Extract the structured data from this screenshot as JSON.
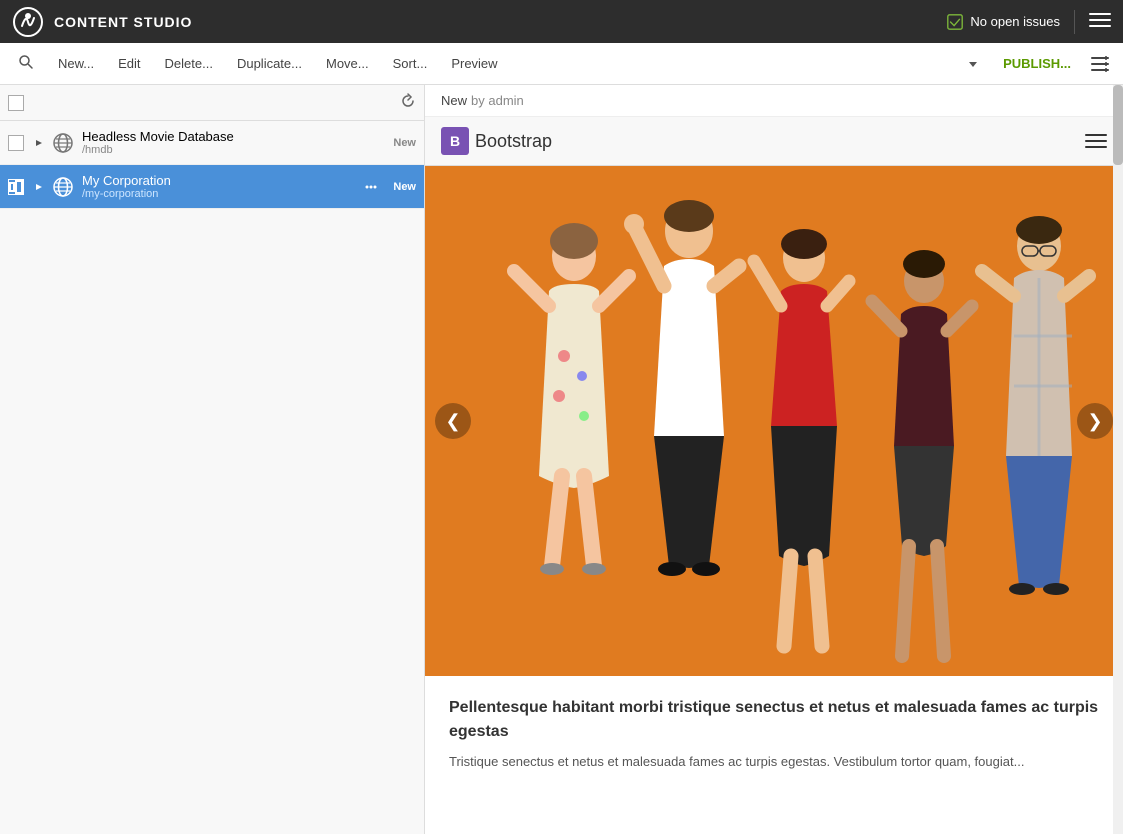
{
  "app": {
    "title": "CONTENT STUDIO",
    "no_issues_label": "No open issues"
  },
  "toolbar": {
    "search_label": "🔍",
    "new_label": "New...",
    "edit_label": "Edit",
    "delete_label": "Delete...",
    "duplicate_label": "Duplicate...",
    "move_label": "Move...",
    "sort_label": "Sort...",
    "preview_label": "Preview",
    "publish_label": "PUBLISH..."
  },
  "tree": {
    "items": [
      {
        "id": "hmdb",
        "name": "Headless Movie Database",
        "path": "/hmdb",
        "badge": "New",
        "selected": false
      },
      {
        "id": "my-corporation",
        "name": "My Corporation",
        "path": "/my-corporation",
        "badge": "New",
        "selected": true
      }
    ]
  },
  "preview": {
    "status": "New",
    "by_label": "by admin",
    "bootstrap_text": "Bootstrap",
    "heading": "Pellentesque habitant morbi tristique senectus et netus et malesuada fames ac turpis egestas",
    "subtext": "Tristique senectus et netus et malesuada fames ac turpis egestas. Vestibulum tortor quam, fougiat...",
    "carousel_prev": "❮",
    "carousel_next": "❯"
  }
}
